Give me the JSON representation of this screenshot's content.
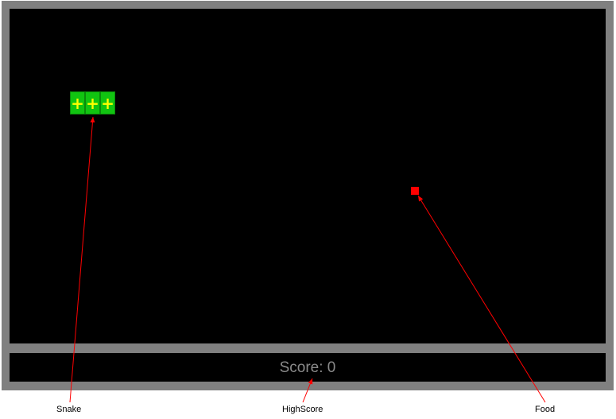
{
  "game": {
    "score_text": "Score: 0",
    "snake_segment_glyph": "+",
    "snake_length": 3
  },
  "annotations": {
    "snake_label": "Snake",
    "highscore_label": "HighScore",
    "food_label": "Food"
  },
  "colors": {
    "frame": "#808080",
    "board": "#000000",
    "snake": "#11c411",
    "snake_mark": "#ffff00",
    "food": "#ff0000",
    "score_text": "#8a8a8a",
    "annotation_line": "#ff0000"
  }
}
